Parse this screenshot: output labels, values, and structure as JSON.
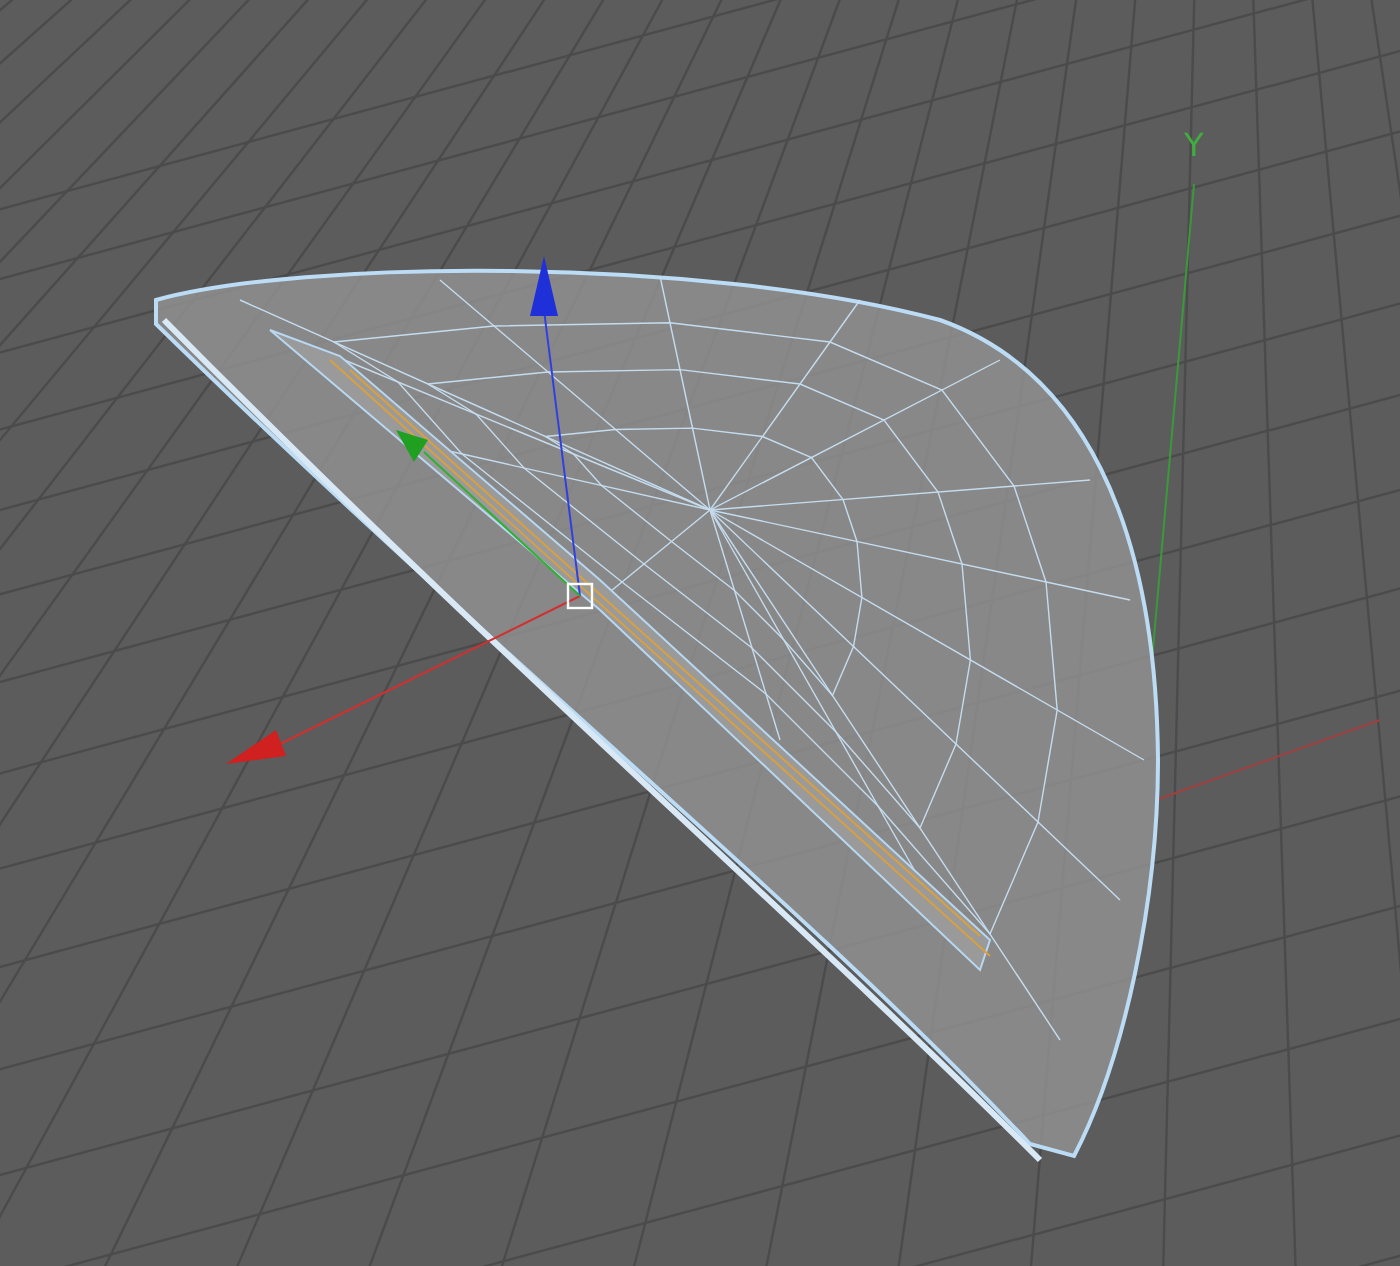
{
  "viewport": {
    "world_axis": {
      "label": "Y"
    }
  }
}
